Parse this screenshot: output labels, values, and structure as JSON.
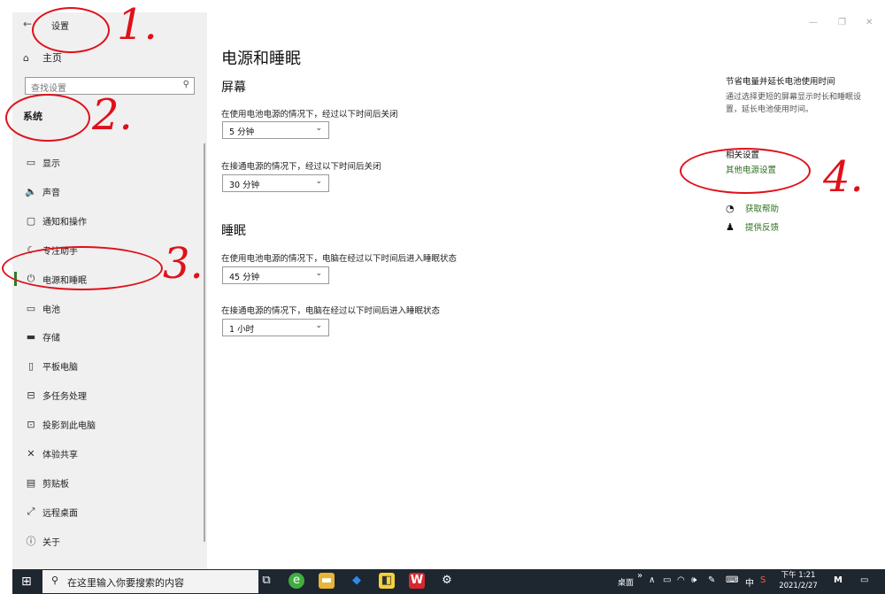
{
  "sidebar": {
    "back_icon": "←",
    "app_title": "设置",
    "home_label": "主页",
    "search_placeholder": "查找设置",
    "section_title": "系统",
    "items": [
      {
        "label": "显示",
        "icon": "▭"
      },
      {
        "label": "声音",
        "icon": "🔈"
      },
      {
        "label": "通知和操作",
        "icon": "▢"
      },
      {
        "label": "专注助手",
        "icon": "☾"
      },
      {
        "label": "电源和睡眠",
        "icon": "⏻"
      },
      {
        "label": "电池",
        "icon": "▭"
      },
      {
        "label": "存储",
        "icon": "▬"
      },
      {
        "label": "平板电脑",
        "icon": "▯"
      },
      {
        "label": "多任务处理",
        "icon": "⊟"
      },
      {
        "label": "投影到此电脑",
        "icon": "⊡"
      },
      {
        "label": "体验共享",
        "icon": "✕"
      },
      {
        "label": "剪贴板",
        "icon": "▤"
      },
      {
        "label": "远程桌面",
        "icon": "⤢"
      },
      {
        "label": "关于",
        "icon": "ⓘ"
      }
    ],
    "active_index": 4
  },
  "main": {
    "title": "电源和睡眠",
    "screen": {
      "heading": "屏幕",
      "battery_desc": "在使用电池电源的情况下，经过以下时间后关闭",
      "battery_value": "5 分钟",
      "plugged_desc": "在接通电源的情况下，经过以下时间后关闭",
      "plugged_value": "30 分钟"
    },
    "sleep": {
      "heading": "睡眠",
      "battery_desc": "在使用电池电源的情况下，电脑在经过以下时间后进入睡眠状态",
      "battery_value": "45 分钟",
      "plugged_desc": "在接通电源的情况下，电脑在经过以下时间后进入睡眠状态",
      "plugged_value": "1 小时"
    }
  },
  "right_panel": {
    "tip_title": "节省电量并延长电池使用时间",
    "tip_desc": "通过选择更短的屏幕显示时长和睡眠设置，延长电池使用时间。",
    "related_heading": "相关设置",
    "other_power_link": "其他电源设置",
    "get_help": "获取帮助",
    "feedback": "提供反馈"
  },
  "window_controls": {
    "minimize": "—",
    "maximize": "❐",
    "close": "✕"
  },
  "taskbar": {
    "search_placeholder": "在这里输入你要搜索的内容",
    "desktop_label": "桌面",
    "ime_label": "中",
    "time": "下午 1:21",
    "date": "2021/2/27"
  },
  "annotations": [
    "1.",
    "2.",
    "3.",
    "4."
  ],
  "colors": {
    "accent_green": "#2d6e1f",
    "annotation_red": "#e0101a",
    "taskbar": "#1e2630"
  }
}
